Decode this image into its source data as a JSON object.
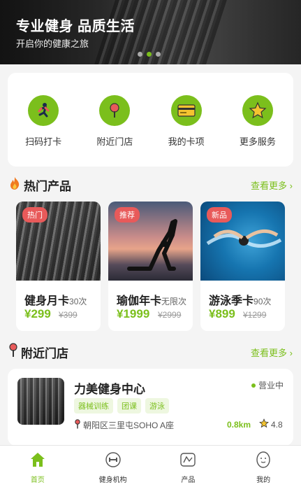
{
  "banner": {
    "title": "专业健身 品质生活",
    "subtitle": "开启你的健康之旅",
    "slides": 3,
    "active_slide": 2
  },
  "quick_menu": [
    {
      "label": "扫码打卡",
      "icon": "running-man-icon"
    },
    {
      "label": "附近门店",
      "icon": "map-pin-icon"
    },
    {
      "label": "我的卡项",
      "icon": "card-icon"
    },
    {
      "label": "更多服务",
      "icon": "star-icon"
    }
  ],
  "hot_products": {
    "title": "热门产品",
    "more": "查看更多 ›",
    "icon": "fire-icon",
    "items": [
      {
        "badge": "热门",
        "name": "健身月卡",
        "detail": "30次",
        "price": "¥299",
        "old_price": "¥399",
        "image": "dumbbell-rack-photo"
      },
      {
        "badge": "推荐",
        "name": "瑜伽年卡",
        "detail": "无限次",
        "price": "¥1999",
        "old_price": "¥2999",
        "image": "yoga-sunset-photo"
      },
      {
        "badge": "新品",
        "name": "游泳季卡",
        "detail": "90次",
        "price": "¥899",
        "old_price": "¥1299",
        "image": "swimmer-photo"
      }
    ]
  },
  "nearby": {
    "title": "附近门店",
    "more": "查看更多 ›",
    "icon": "map-pin-icon",
    "store": {
      "name": "力美健身中心",
      "status": "营业中",
      "tags": [
        "器械训练",
        "团课",
        "游泳"
      ],
      "address": "朝阳区三里屯SOHO A座",
      "distance": "0.8km",
      "rating": "4.8"
    }
  },
  "tabs": [
    {
      "label": "首页",
      "icon": "home-icon",
      "active": true
    },
    {
      "label": "健身机构",
      "icon": "gym-icon",
      "active": false
    },
    {
      "label": "产品",
      "icon": "product-icon",
      "active": false
    },
    {
      "label": "我的",
      "icon": "profile-icon",
      "active": false
    }
  ],
  "colors": {
    "accent": "#7bbf1c",
    "badge": "#e85a5a",
    "background": "#f4f4f4"
  }
}
